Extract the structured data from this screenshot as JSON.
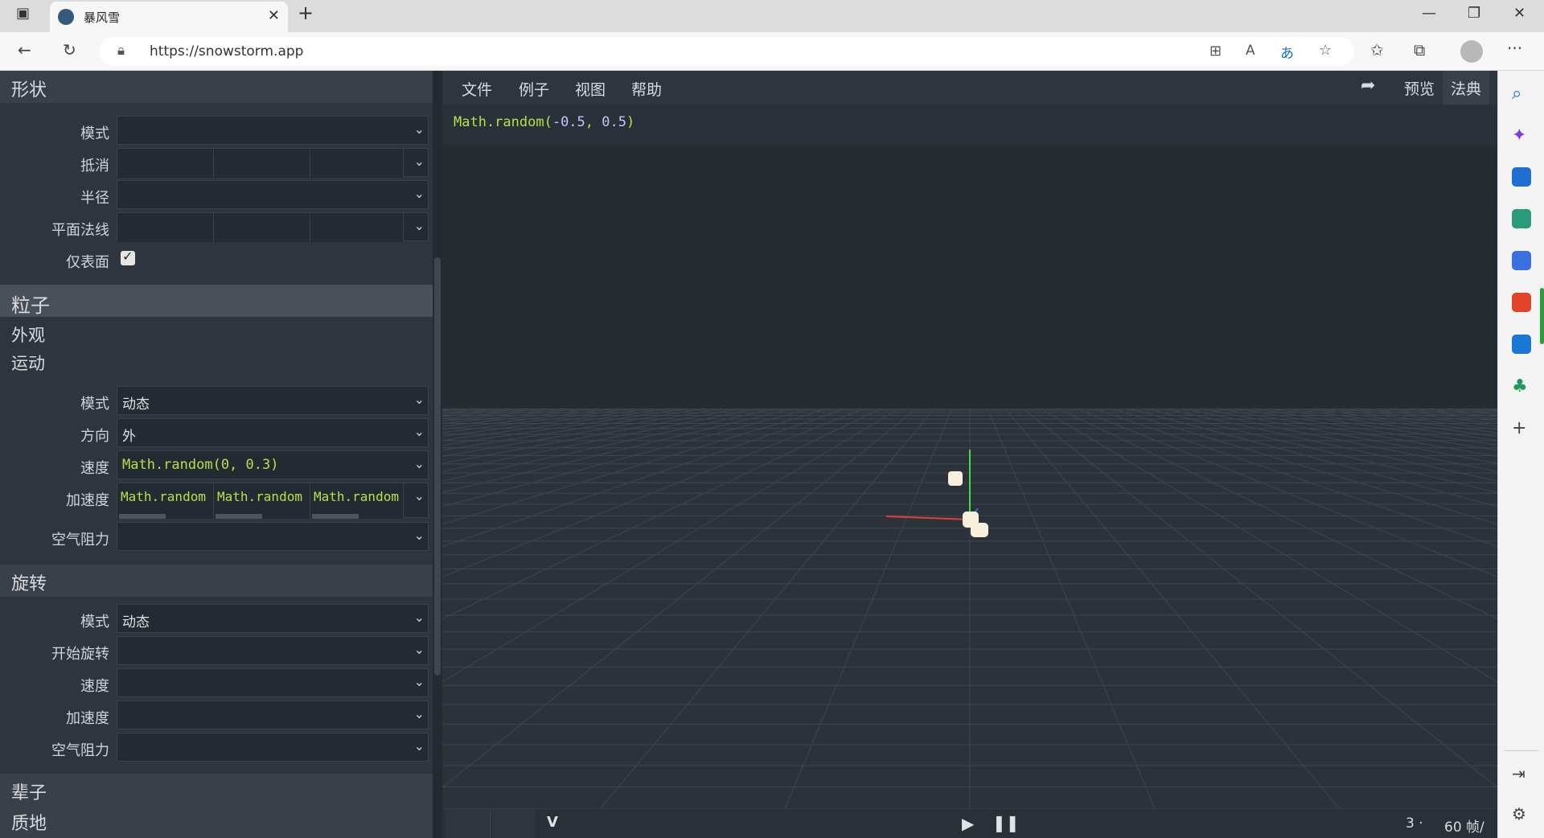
{
  "browser": {
    "tab_title": "暴风雪",
    "url": "https://snowstorm.app",
    "new_tab": "+",
    "tab_close": "✕",
    "more": "···"
  },
  "left": {
    "shape": {
      "header": "形状",
      "mode_label": "模式",
      "mode_value": "",
      "offset_label": "抵消",
      "radius_label": "半径",
      "normal_label": "平面法线",
      "surface_only_label": "仅表面",
      "surface_only": true
    },
    "particle_header": "粒子",
    "appearance": "外观",
    "motion": {
      "header": "运动",
      "mode_label": "模式",
      "mode_value": "动态",
      "direction_label": "方向",
      "direction_value": "外",
      "speed_label": "速度",
      "speed_value": "Math.random(0, 0.3)",
      "accel_label": "加速度",
      "accel_values": [
        "Math.random",
        "Math.random",
        "Math.random"
      ],
      "drag_label": "空气阻力"
    },
    "rotation": {
      "header": "旋转",
      "mode_label": "模式",
      "mode_value": "动态",
      "start_label": "开始旋转",
      "speed_label": "速度",
      "accel_label": "加速度",
      "drag_label": "空气阻力"
    },
    "lifetime": "辈子",
    "texture": "质地"
  },
  "center": {
    "menus": [
      "文件",
      "例子",
      "视图",
      "帮助"
    ],
    "preview_tab": "预览",
    "codex_tab": "法典",
    "expression": "Math.random(-0.5, 0.5)",
    "bottom_left_label": "V",
    "count": "3 ·",
    "fps": "60 帧/"
  },
  "colors": {
    "code_green": "#b5e04c",
    "code_number": "#c8c2ff",
    "panel_bg": "#2f353e",
    "viewport_bg": "#272c33"
  }
}
